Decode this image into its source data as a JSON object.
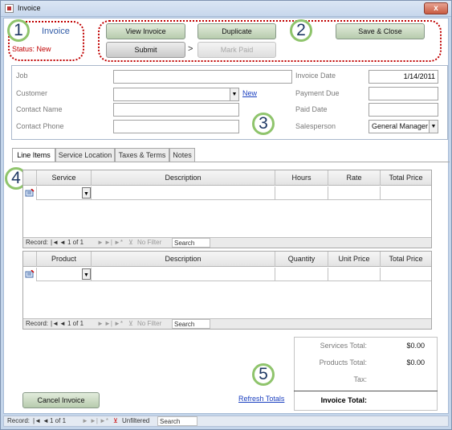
{
  "window": {
    "title": "Invoice",
    "close_glyph": "x"
  },
  "header": {
    "title": "Invoice",
    "status": "Status: New"
  },
  "actions": {
    "view_invoice": "View Invoice",
    "duplicate": "Duplicate",
    "save_close": "Save & Close",
    "submit": "Submit",
    "arrow": ">",
    "mark_paid": "Mark Paid"
  },
  "callouts": [
    "1",
    "2",
    "3",
    "4",
    "5"
  ],
  "details": {
    "job_label": "Job",
    "customer_label": "Customer",
    "contact_name_label": "Contact Name",
    "contact_phone_label": "Contact Phone",
    "new_link": "New",
    "invoice_date_label": "Invoice Date",
    "invoice_date_value": "1/14/2011",
    "payment_due_label": "Payment Due",
    "paid_date_label": "Paid Date",
    "salesperson_label": "Salesperson",
    "salesperson_value": "General Manager"
  },
  "tabs": [
    "Line Items",
    "Service Location",
    "Taxes & Terms",
    "Notes"
  ],
  "services_table": {
    "columns": [
      "Service",
      "Description",
      "Hours",
      "Rate",
      "Total Price"
    ]
  },
  "products_table": {
    "columns": [
      "Product",
      "Description",
      "Quantity",
      "Unit Price",
      "Total Price"
    ]
  },
  "subform_nav": {
    "record": "Record:",
    "position": "1 of 1",
    "filter": "No Filter",
    "search": "Search"
  },
  "totals": {
    "services_label": "Services Total:",
    "services_value": "$0.00",
    "products_label": "Products Total:",
    "products_value": "$0.00",
    "tax_label": "Tax:",
    "invoice_label": "Invoice Total:"
  },
  "refresh_link": "Refresh Totals",
  "cancel_button": "Cancel Invoice",
  "statusbar": {
    "record": "Record:",
    "position": "1 of 1",
    "filter": "Unfiltered",
    "search": "Search"
  },
  "icons": {
    "nav_first": "|◄",
    "nav_prev": "◄",
    "nav_next": "►",
    "nav_last": "►|",
    "nav_new": "►*",
    "filter": "funnel-icon",
    "dropdown": "▼"
  }
}
